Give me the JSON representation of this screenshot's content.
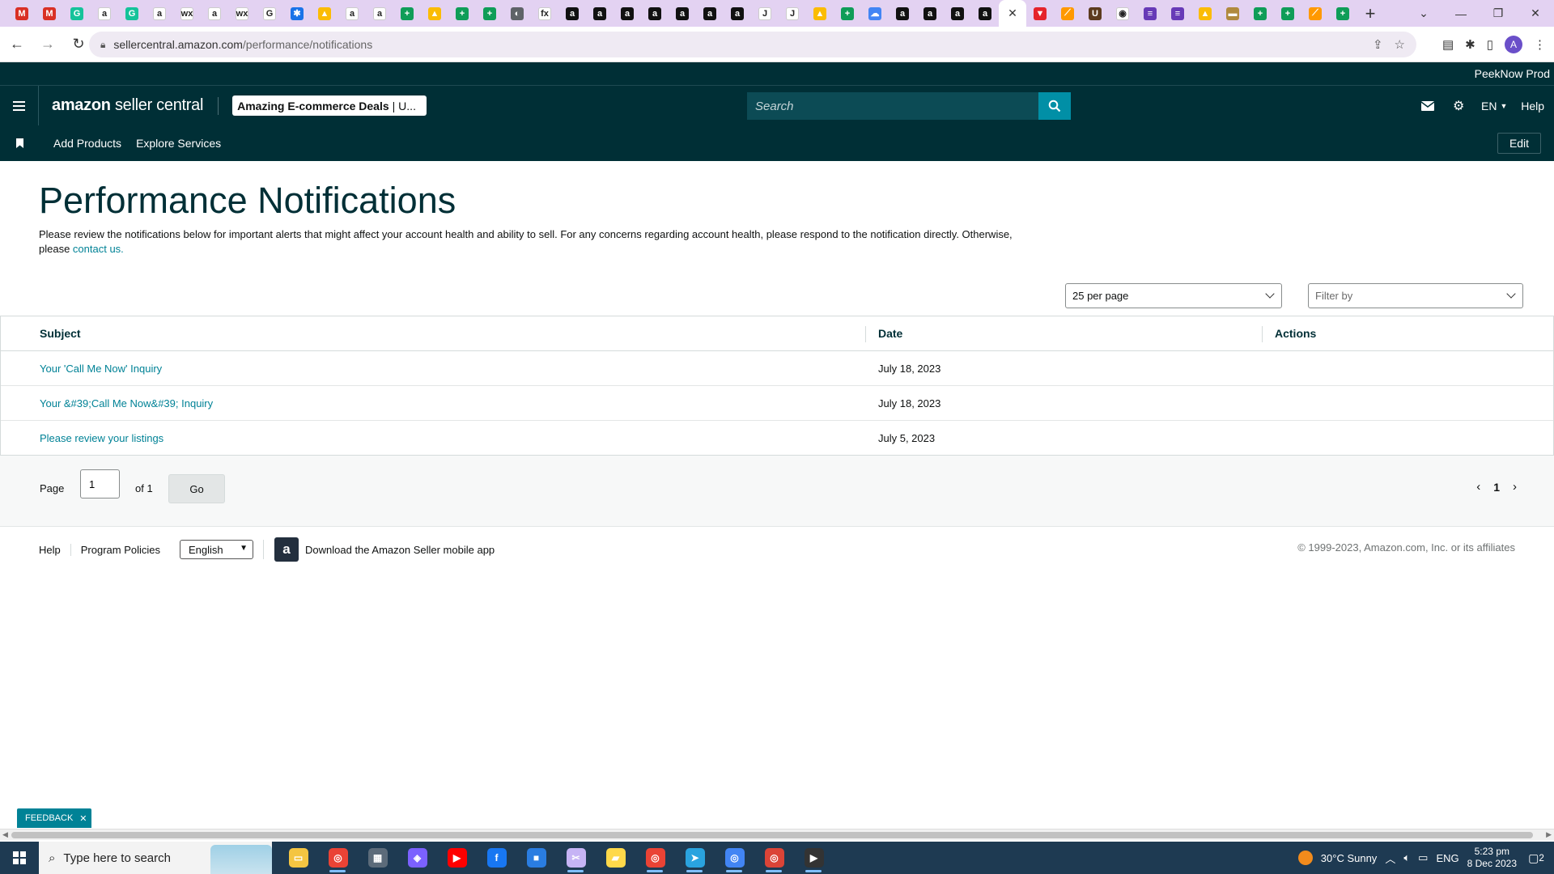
{
  "browser": {
    "tabs": [
      {
        "icon": "gmail-icon",
        "color": "#d93025",
        "glyph": "M"
      },
      {
        "icon": "gmail-icon",
        "color": "#d93025",
        "glyph": "M"
      },
      {
        "icon": "grammarly-icon",
        "color": "#15c39a",
        "glyph": "G"
      },
      {
        "icon": "amazon-icon",
        "color": "#ffffff",
        "glyph": "a"
      },
      {
        "icon": "grammarly-icon",
        "color": "#15c39a",
        "glyph": "G"
      },
      {
        "icon": "amazon-icon",
        "color": "#ffffff",
        "glyph": "a"
      },
      {
        "icon": "wix-icon",
        "color": "#ffffff",
        "glyph": "wx"
      },
      {
        "icon": "amazon-icon",
        "color": "#ffffff",
        "glyph": "a"
      },
      {
        "icon": "wix-icon",
        "color": "#ffffff",
        "glyph": "wx"
      },
      {
        "icon": "google-icon",
        "color": "#ffffff",
        "glyph": "G"
      },
      {
        "icon": "puzzle-icon",
        "color": "#1a73e8",
        "glyph": "✱"
      },
      {
        "icon": "drive-icon",
        "color": "#fbbc04",
        "glyph": "▲"
      },
      {
        "icon": "amazon-icon",
        "color": "#ffffff",
        "glyph": "a"
      },
      {
        "icon": "amazon-icon",
        "color": "#ffffff",
        "glyph": "a"
      },
      {
        "icon": "sheets-icon",
        "color": "#0f9d58",
        "glyph": "+"
      },
      {
        "icon": "drive-icon",
        "color": "#fbbc04",
        "glyph": "▲"
      },
      {
        "icon": "sheets-icon",
        "color": "#0f9d58",
        "glyph": "+"
      },
      {
        "icon": "sheets-icon",
        "color": "#0f9d58",
        "glyph": "+"
      },
      {
        "icon": "globe-icon",
        "color": "#5f6368",
        "glyph": "◐"
      },
      {
        "icon": "fedex-icon",
        "color": "#ffffff",
        "glyph": "fx"
      },
      {
        "icon": "amazon-icon",
        "color": "#111111",
        "glyph": "a"
      },
      {
        "icon": "amazon-icon",
        "color": "#111111",
        "glyph": "a"
      },
      {
        "icon": "amazon-icon",
        "color": "#111111",
        "glyph": "a"
      },
      {
        "icon": "amazon-icon",
        "color": "#111111",
        "glyph": "a"
      },
      {
        "icon": "amazon-icon",
        "color": "#111111",
        "glyph": "a"
      },
      {
        "icon": "amazon-icon",
        "color": "#111111",
        "glyph": "a"
      },
      {
        "icon": "amazon-icon",
        "color": "#111111",
        "glyph": "a"
      },
      {
        "icon": "script-icon",
        "color": "#ffffff",
        "glyph": "J"
      },
      {
        "icon": "script-icon",
        "color": "#ffffff",
        "glyph": "J"
      },
      {
        "icon": "drive-icon",
        "color": "#fbbc04",
        "glyph": "▲"
      },
      {
        "icon": "sheets-icon",
        "color": "#0f9d58",
        "glyph": "+"
      },
      {
        "icon": "cloud-icon",
        "color": "#4285f4",
        "glyph": "☁"
      },
      {
        "icon": "amazon-icon",
        "color": "#111111",
        "glyph": "a"
      },
      {
        "icon": "amazon-icon",
        "color": "#111111",
        "glyph": "a"
      },
      {
        "icon": "amazon-icon",
        "color": "#111111",
        "glyph": "a"
      },
      {
        "icon": "amazon-icon",
        "color": "#111111",
        "glyph": "a"
      }
    ],
    "tabs_after": [
      {
        "icon": "vpn-icon",
        "color": "#e5242b",
        "glyph": "▼"
      },
      {
        "icon": "brush-icon",
        "color": "#ff9900",
        "glyph": "⟋"
      },
      {
        "icon": "ups-icon",
        "color": "#5c3b1e",
        "glyph": "U"
      },
      {
        "icon": "keepa-icon",
        "color": "#ffffff",
        "glyph": "◉"
      },
      {
        "icon": "forms-icon",
        "color": "#673ab7",
        "glyph": "≡"
      },
      {
        "icon": "forms-icon",
        "color": "#673ab7",
        "glyph": "≡"
      },
      {
        "icon": "drive-icon",
        "color": "#fbbc04",
        "glyph": "▲"
      },
      {
        "icon": "pallet-icon",
        "color": "#b08a3e",
        "glyph": "▬"
      },
      {
        "icon": "sheets-icon",
        "color": "#0f9d58",
        "glyph": "+"
      },
      {
        "icon": "sheets-icon",
        "color": "#0f9d58",
        "glyph": "+"
      },
      {
        "icon": "brush-icon",
        "color": "#ff9900",
        "glyph": "⟋"
      },
      {
        "icon": "sheets-icon",
        "color": "#0f9d58",
        "glyph": "+"
      }
    ],
    "active_tab_glyph": "✕",
    "new_tab_glyph": "+",
    "url_host": "sellercentral.amazon.com",
    "url_path": "/performance/notifications",
    "profile_initial": "A"
  },
  "seller": {
    "account_name": "PeekNow Prod",
    "logo_amazon": "amazon",
    "logo_sc": "seller central",
    "store_name": "Amazing E-commerce Deals",
    "store_marketplace": "| U...",
    "search_placeholder": "Search",
    "lang": "EN",
    "help": "Help",
    "nav": {
      "add_products": "Add Products",
      "explore_services": "Explore Services",
      "edit": "Edit"
    }
  },
  "page": {
    "title": "Performance Notifications",
    "desc_text": "Please review the notifications below for important alerts that might affect your account health and ability to sell. For any concerns regarding account health, please respond to the notification directly. Otherwise, please ",
    "desc_link": "contact us.",
    "per_page": "25 per page",
    "filter_by": "Filter by",
    "columns": {
      "subject": "Subject",
      "date": "Date",
      "actions": "Actions"
    },
    "rows": [
      {
        "subject": "Your 'Call Me Now' Inquiry",
        "date": "July 18, 2023",
        "action": ""
      },
      {
        "subject": "Your &#39;Call Me Now&#39; Inquiry",
        "date": "July 18, 2023",
        "action": ""
      },
      {
        "subject": "Please review your listings",
        "date": "July 5, 2023",
        "action": ""
      }
    ],
    "pagination": {
      "page_label": "Page",
      "page_value": "1",
      "of_label": "of 1",
      "go": "Go",
      "current": "1"
    }
  },
  "footer": {
    "help": "Help",
    "program_policies": "Program Policies",
    "language": "English",
    "download_app": "Download the Amazon Seller mobile app",
    "copyright": "© 1999-2023, Amazon.com, Inc. or its affiliates"
  },
  "feedback": {
    "label": "FEEDBACK",
    "close": "✕"
  },
  "taskbar": {
    "search_placeholder": "Type here to search",
    "apps": [
      {
        "name": "file-explorer-icon",
        "color": "#f4c542",
        "glyph": "▭",
        "active": false
      },
      {
        "name": "chrome-icon",
        "color": "#ea4335",
        "glyph": "◎",
        "active": true
      },
      {
        "name": "calculator-icon",
        "color": "#5c6b7a",
        "glyph": "▦",
        "active": false
      },
      {
        "name": "copilot-icon",
        "color": "#7b61ff",
        "glyph": "◈",
        "active": false
      },
      {
        "name": "youtube-icon",
        "color": "#ff0000",
        "glyph": "▶",
        "active": false
      },
      {
        "name": "facebook-icon",
        "color": "#1877f2",
        "glyph": "f",
        "active": false
      },
      {
        "name": "store-icon",
        "color": "#2a7de1",
        "glyph": "■",
        "active": false
      },
      {
        "name": "snipping-icon",
        "color": "#c6b4f5",
        "glyph": "✂",
        "active": true
      },
      {
        "name": "sticky-notes-icon",
        "color": "#ffd94a",
        "glyph": "▰",
        "active": false
      },
      {
        "name": "chrome-profile-icon",
        "color": "#ea4335",
        "glyph": "◎",
        "active": true
      },
      {
        "name": "telegram-icon",
        "color": "#2aa3df",
        "glyph": "➤",
        "active": true
      },
      {
        "name": "chrome-profile-icon",
        "color": "#4285f4",
        "glyph": "◎",
        "active": true
      },
      {
        "name": "chrome-profile-icon",
        "color": "#db4437",
        "glyph": "◎",
        "active": true
      },
      {
        "name": "media-player-icon",
        "color": "#333333",
        "glyph": "▶",
        "active": true
      }
    ],
    "weather": "30°C  Sunny",
    "ime": "ENG",
    "time": "5:23 pm",
    "date": "8 Dec 2023",
    "notifications": "2"
  }
}
